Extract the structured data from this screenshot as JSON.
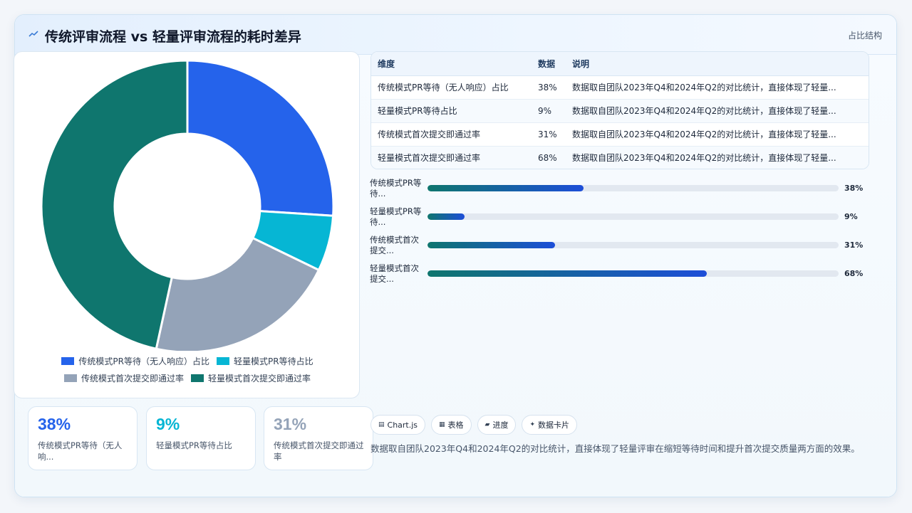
{
  "header": {
    "icon": "chart-line-icon",
    "title": "传统评审流程 vs 轻量评审流程的耗时差异",
    "tag": "占比结构"
  },
  "chart_data": {
    "type": "pie",
    "variant": "donut",
    "categories": [
      "传统模式PR等待（无人响应）占比",
      "轻量模式PR等待占比",
      "传统模式首次提交即通过率",
      "轻量模式首次提交即通过率"
    ],
    "values": [
      38,
      9,
      31,
      68
    ],
    "colors": [
      "#2563eb",
      "#06b6d4",
      "#94a3b8",
      "#0f766e"
    ],
    "legend_position": "bottom"
  },
  "legend": {
    "items": [
      {
        "label": "传统模式PR等待（无人响应）占比",
        "color": "#2563eb"
      },
      {
        "label": "轻量模式PR等待占比",
        "color": "#06b6d4"
      },
      {
        "label": "传统模式首次提交即通过率",
        "color": "#94a3b8"
      },
      {
        "label": "轻量模式首次提交即通过率",
        "color": "#0f766e"
      }
    ]
  },
  "stats": [
    {
      "value": "38%",
      "label": "传统模式PR等待（无人响...",
      "color": "#2563eb"
    },
    {
      "value": "9%",
      "label": "轻量模式PR等待占比",
      "color": "#06b6d4"
    },
    {
      "value": "31%",
      "label": "传统模式首次提交即通过率",
      "color": "#94a3b8"
    }
  ],
  "table": {
    "headers": [
      "维度",
      "数据",
      "说明"
    ],
    "rows": [
      [
        "传统模式PR等待（无人响应）占比",
        "38%",
        "数据取自团队2023年Q4和2024年Q2的对比统计，直接体现了轻量..."
      ],
      [
        "轻量模式PR等待占比",
        "9%",
        "数据取自团队2023年Q4和2024年Q2的对比统计，直接体现了轻量..."
      ],
      [
        "传统模式首次提交即通过率",
        "31%",
        "数据取自团队2023年Q4和2024年Q2的对比统计，直接体现了轻量..."
      ],
      [
        "轻量模式首次提交即通过率",
        "68%",
        "数据取自团队2023年Q4和2024年Q2的对比统计，直接体现了轻量..."
      ]
    ]
  },
  "progress": [
    {
      "label": "传统模式PR等待...",
      "value": 38,
      "text": "38%"
    },
    {
      "label": "轻量模式PR等待...",
      "value": 9,
      "text": "9%"
    },
    {
      "label": "传统模式首次提交...",
      "value": 31,
      "text": "31%"
    },
    {
      "label": "轻量模式首次提交...",
      "value": 68,
      "text": "68%"
    }
  ],
  "chips": [
    {
      "icon": "▤",
      "label": "Chart.js"
    },
    {
      "icon": "▦",
      "label": "表格"
    },
    {
      "icon": "▰",
      "label": "进度"
    },
    {
      "icon": "✦",
      "label": "数据卡片"
    }
  ],
  "note": "数据取自团队2023年Q4和2024年Q2的对比统计，直接体现了轻量评审在缩短等待时间和提升首次提交质量两方面的效果。"
}
